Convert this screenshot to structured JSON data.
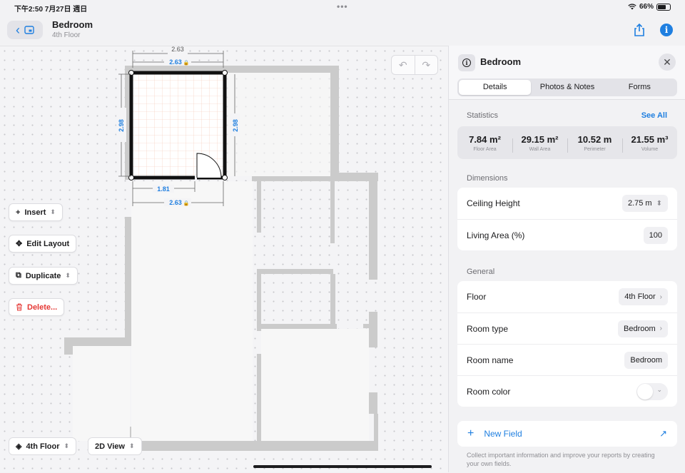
{
  "status_bar": {
    "time": "下午2:50  7月27日 週日",
    "dots": "•••",
    "battery": "66%"
  },
  "nav": {
    "title": "Bedroom",
    "subtitle": "4th Floor",
    "back_icon": "chevron-left-icon",
    "share_icon": "share-icon",
    "info_icon": "info-icon",
    "info_glyph": "i"
  },
  "plan": {
    "dim_top_outer": "2.63",
    "dim_top_inner": "2.63",
    "dim_left": "2.98",
    "dim_right": "2.98",
    "dim_bottom_inner": "1.81",
    "dim_bottom_outer": "2.63",
    "lock_glyph": "🔒"
  },
  "toolbar": {
    "undo": "↶",
    "redo": "↷"
  },
  "tools": {
    "insert": "Insert",
    "edit_layout": "Edit Layout",
    "duplicate": "Duplicate",
    "delete": "Delete...",
    "chevron": "⌃⌄"
  },
  "bottom": {
    "floor": "4th Floor",
    "view": "2D View"
  },
  "panel": {
    "title": "Bedroom",
    "close": "✕",
    "tabs": [
      "Details",
      "Photos & Notes",
      "Forms"
    ],
    "statistics_label": "Statistics",
    "see_all": "See All",
    "stats": [
      {
        "value": "7.84 m²",
        "label": "Floor Area"
      },
      {
        "value": "29.15 m²",
        "label": "Wall Area"
      },
      {
        "value": "10.52 m",
        "label": "Perimeter"
      },
      {
        "value": "21.55 m³",
        "label": "Volume"
      }
    ],
    "dimensions_label": "Dimensions",
    "ceiling_height_label": "Ceiling Height",
    "ceiling_height_value": "2.75 m",
    "living_area_label": "Living Area (%)",
    "living_area_value": "100",
    "general_label": "General",
    "floor_label": "Floor",
    "floor_value": "4th Floor",
    "room_type_label": "Room type",
    "room_type_value": "Bedroom",
    "room_name_label": "Room name",
    "room_name_value": "Bedroom",
    "room_color_label": "Room color",
    "new_field": "New Field",
    "hint": "Collect important information and improve your reports by creating your own fields."
  },
  "colors": {
    "accent": "#1f7fe0",
    "danger": "#e53935",
    "wall": "#c9c9c9",
    "dim_blue": "#1f7fe0"
  }
}
